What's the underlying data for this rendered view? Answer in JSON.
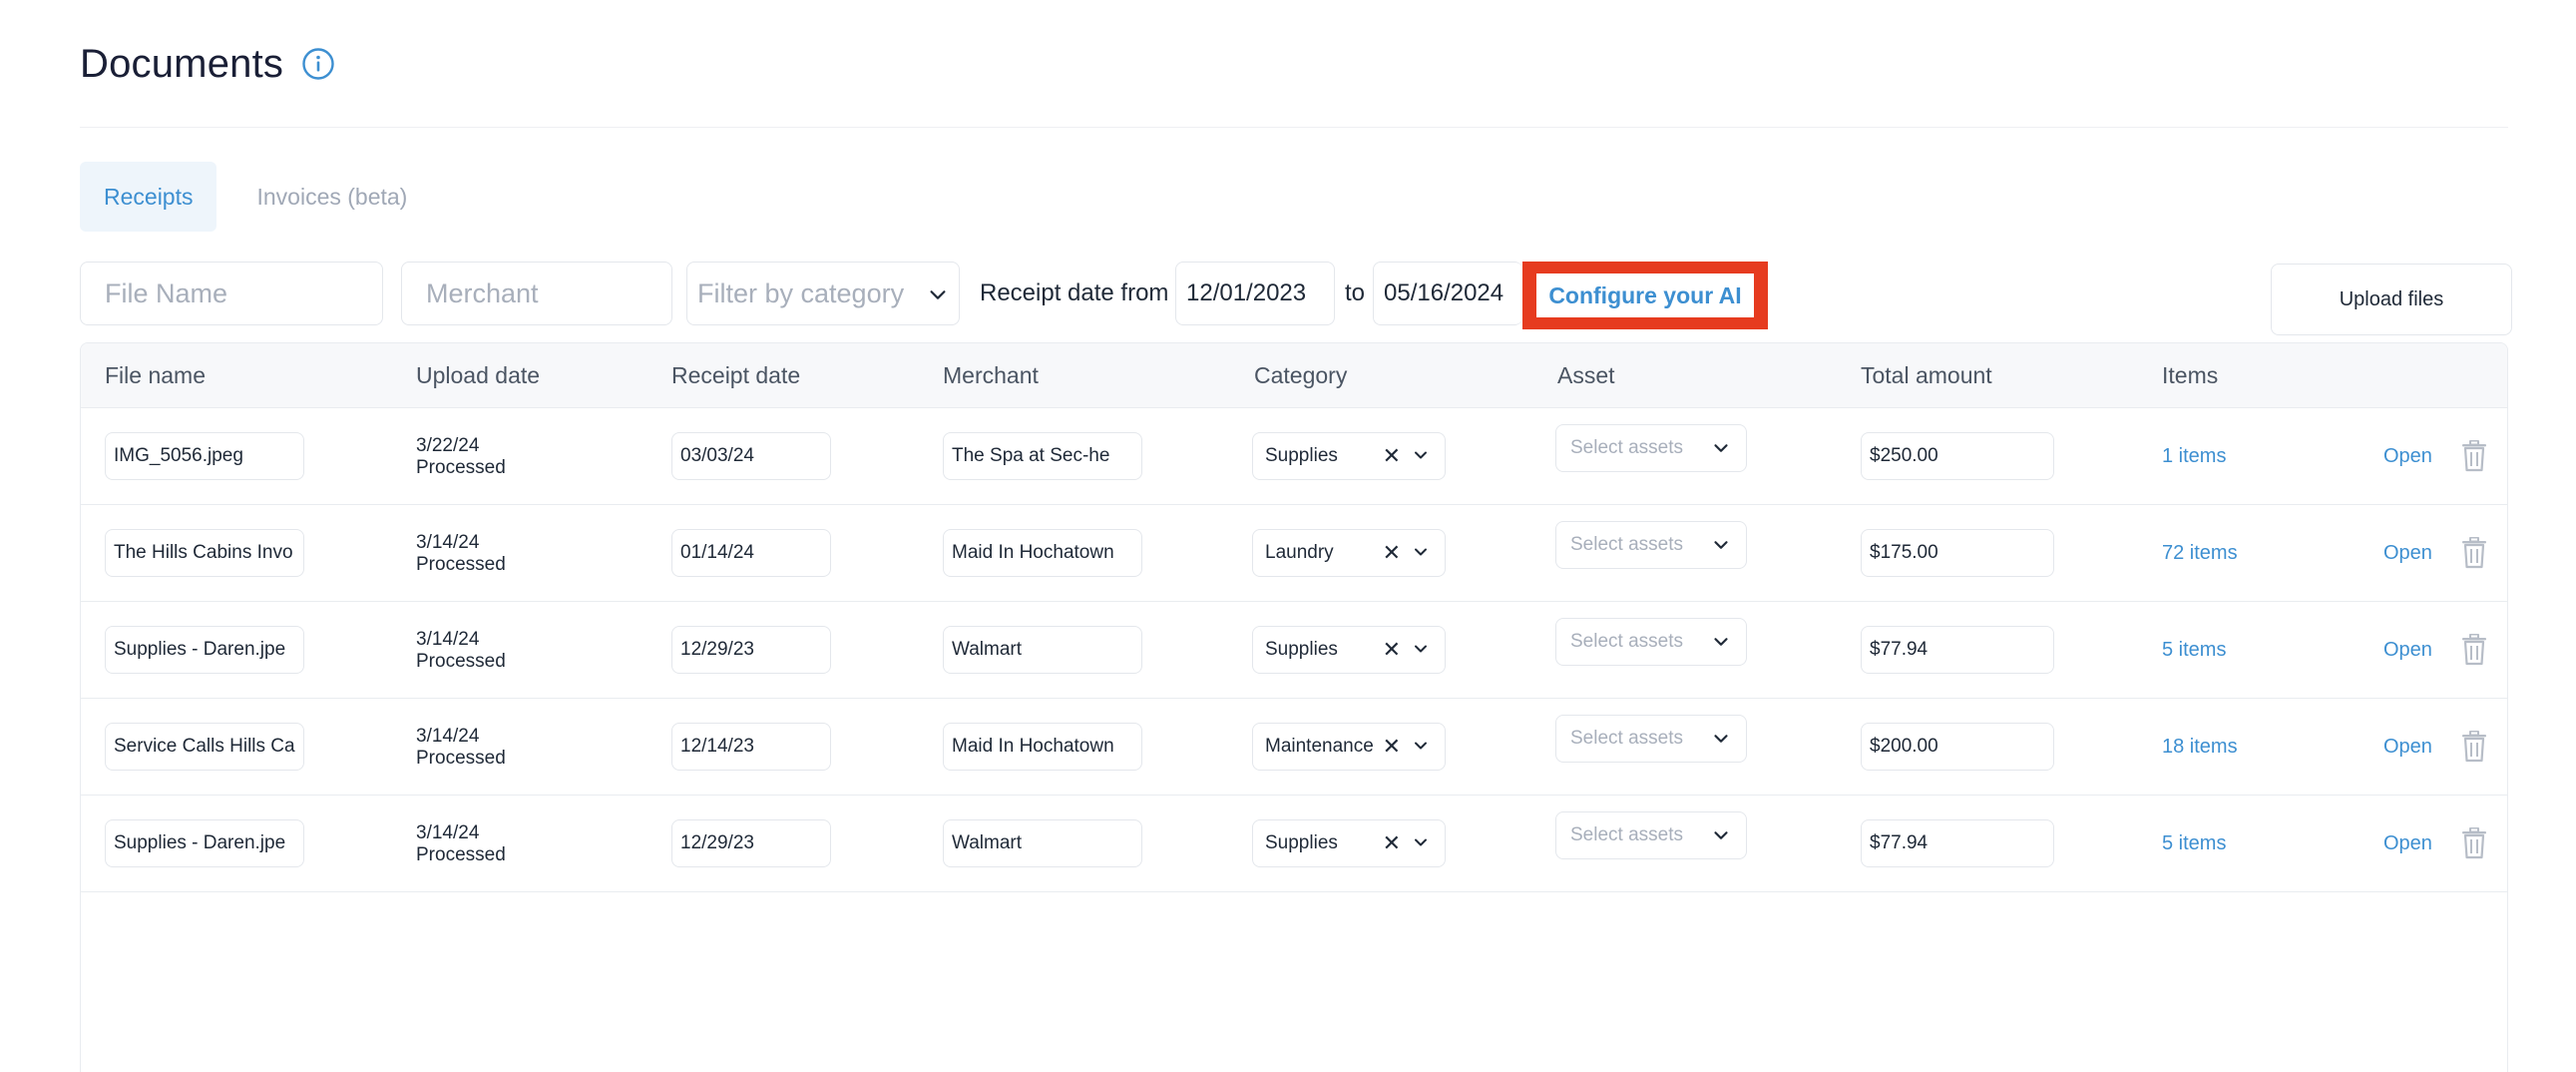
{
  "page": {
    "title": "Documents"
  },
  "tabs": [
    {
      "label": "Receipts",
      "active": true
    },
    {
      "label": "Invoices (beta)",
      "active": false
    }
  ],
  "filters": {
    "file_name_placeholder": "File Name",
    "merchant_placeholder": "Merchant",
    "category_placeholder": "Filter by category",
    "date_from_label": "Receipt date from",
    "date_from": "12/01/2023",
    "date_to_label": "to",
    "date_to": "05/16/2024",
    "configure_label": "Configure your AI",
    "upload_label": "Upload files"
  },
  "table": {
    "columns": [
      "File name",
      "Upload date",
      "Receipt date",
      "Merchant",
      "Category",
      "Asset",
      "Total amount",
      "Items"
    ],
    "asset_placeholder": "Select assets",
    "open_label": "Open",
    "rows": [
      {
        "file_name": "IMG_5056.jpeg",
        "upload_date": "3/22/24",
        "status": "Processed",
        "receipt_date": "03/03/24",
        "merchant": "The Spa at Sec-he",
        "category": "Supplies",
        "total": "$250.00",
        "items": "1 items"
      },
      {
        "file_name": "The Hills Cabins Invo",
        "upload_date": "3/14/24",
        "status": "Processed",
        "receipt_date": "01/14/24",
        "merchant": "Maid In Hochatown",
        "category": "Laundry",
        "total": "$175.00",
        "items": "72 items"
      },
      {
        "file_name": "Supplies - Daren.jpe",
        "upload_date": "3/14/24",
        "status": "Processed",
        "receipt_date": "12/29/23",
        "merchant": "Walmart",
        "category": "Supplies",
        "total": "$77.94",
        "items": "5 items"
      },
      {
        "file_name": "Service Calls Hills Ca",
        "upload_date": "3/14/24",
        "status": "Processed",
        "receipt_date": "12/14/23",
        "merchant": "Maid In Hochatown",
        "category": "Maintenance",
        "total": "$200.00",
        "items": "18 items"
      },
      {
        "file_name": "Supplies - Daren.jpe",
        "upload_date": "3/14/24",
        "status": "Processed",
        "receipt_date": "12/29/23",
        "merchant": "Walmart",
        "category": "Supplies",
        "total": "$77.94",
        "items": "5 items"
      }
    ]
  },
  "colors": {
    "accent": "#3d8fd1",
    "highlight": "#e63b1f",
    "tab_active_bg": "#eef5fb"
  },
  "icons": {
    "info": "info-circle-icon",
    "dropdown": "chevron-down-icon",
    "clear": "close-icon",
    "delete": "trash-icon"
  }
}
